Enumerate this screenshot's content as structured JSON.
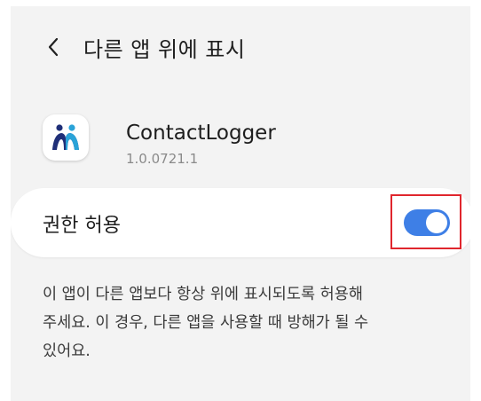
{
  "header": {
    "back_icon": "chevron-left-icon",
    "title": "다른 앱 위에 표시"
  },
  "app": {
    "icon": "contactlogger-app-icon",
    "name": "ContactLogger",
    "version": "1.0.0721.1"
  },
  "permission": {
    "label": "권한 허용",
    "enabled": true
  },
  "description": {
    "lines": [
      "이 앱이 다른 앱보다 항상 위에 표시되도록 허용해",
      "주세요. 이 경우, 다른 앱을 사용할 때 방해가 될 수",
      "있어요."
    ]
  },
  "colors": {
    "background": "#f3f3f3",
    "card": "#ffffff",
    "toggle_on": "#3e7fe6",
    "highlight": "#e0262d",
    "icon_blue": "#2aa3d8",
    "icon_navy": "#1f2f78"
  }
}
